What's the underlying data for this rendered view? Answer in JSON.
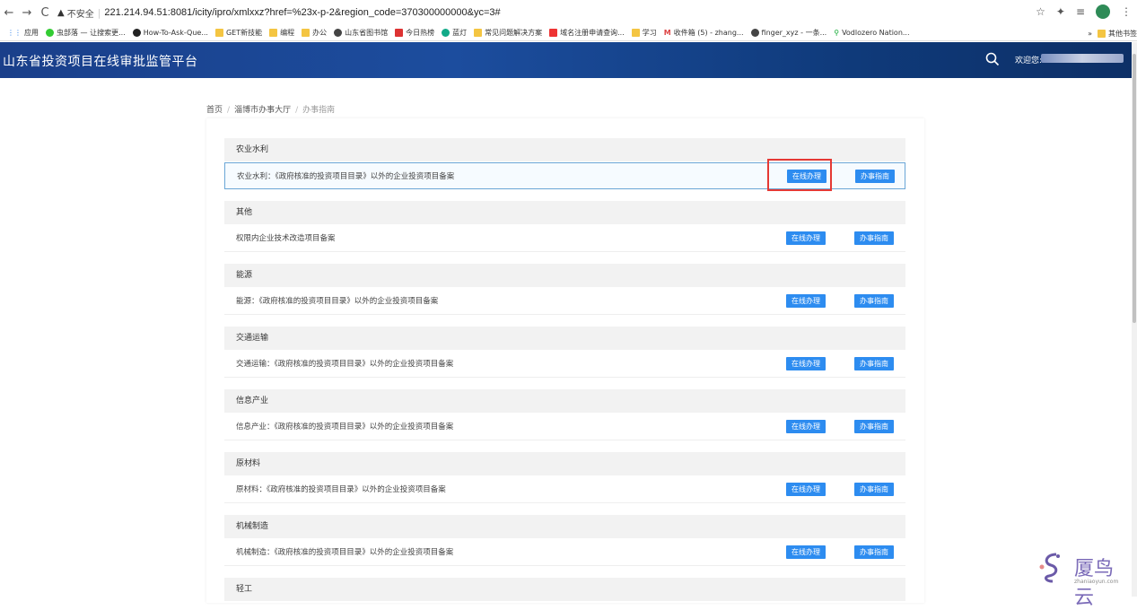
{
  "browser": {
    "secure_label": "不安全",
    "url": "221.214.94.51:8081/icity/ipro/xmlxxz?href=%23x-p-2&region_code=370300000000&yc=3#",
    "bookmarks": [
      "应用",
      "虫部落 — 让搜索更...",
      "How-To-Ask-Que...",
      "GET新技能",
      "编程",
      "办公",
      "山东省图书馆",
      "今日热榜",
      "蓝灯",
      "常见问题解决方案",
      "域名注册申请查询...",
      "学习",
      "收件箱 (5) - zhang...",
      "finger_xyz - 一条...",
      "Vodlozero Nation..."
    ],
    "bookmarks_more": "»",
    "other_bookmarks": "其他书签"
  },
  "app": {
    "title": "山东省投资项目在线审批监管平台",
    "welcome": "欢迎您:"
  },
  "breadcrumb": {
    "home": "首页",
    "hall": "淄博市办事大厅",
    "current": "办事指南"
  },
  "categories": [
    {
      "name": "农业水利",
      "item": "农业水利：《政府核准的投资项目目录》以外的企业投资项目备案"
    },
    {
      "name": "其他",
      "item": "权限内企业技术改造项目备案"
    },
    {
      "name": "能源",
      "item": "能源：《政府核准的投资项目目录》以外的企业投资项目备案"
    },
    {
      "name": "交通运输",
      "item": "交通运输：《政府核准的投资项目目录》以外的企业投资项目备案"
    },
    {
      "name": "信息产业",
      "item": "信息产业：《政府核准的投资项目目录》以外的企业投资项目备案"
    },
    {
      "name": "原材料",
      "item": "原材料：《政府核准的投资项目目录》以外的企业投资项目备案"
    },
    {
      "name": "机械制造",
      "item": "机械制造：《政府核准的投资项目目录》以外的企业投资项目备案"
    },
    {
      "name": "轻工",
      "item": ""
    }
  ],
  "buttons": {
    "online": "在线办理",
    "guide": "办事指南"
  },
  "watermark": {
    "text": "厦鸟云",
    "sub": "zhaniaoyun.com"
  },
  "colors": {
    "header_blue": "#1c4d9e",
    "button_blue": "#2d8cf0",
    "highlight_red": "#e53935"
  }
}
